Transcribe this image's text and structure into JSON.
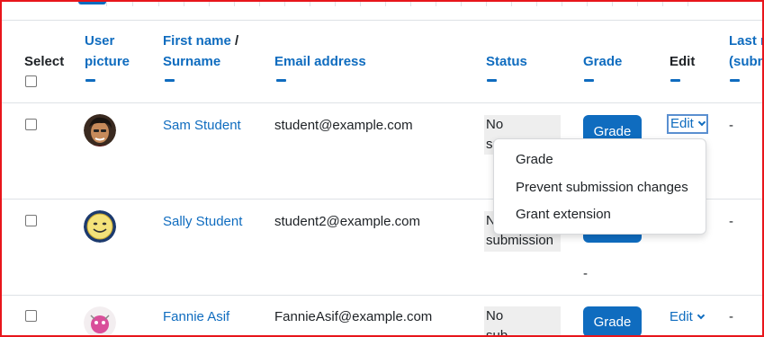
{
  "header": {
    "select": "Select",
    "user_picture_1": "User",
    "user_picture_2": "picture",
    "first_name": "First name",
    "slash": " /",
    "surname": "Surname",
    "email": "Email address",
    "status": "Status",
    "grade": "Grade",
    "edit": "Edit",
    "last_modified_1": "Last m",
    "last_modified_2": "(subm"
  },
  "rows": [
    {
      "name": "Sam Student",
      "email": "student@example.com",
      "status_1": "No",
      "status_2": "sub",
      "grade_button": "Grade",
      "edit_label": "Edit",
      "last_modified": "-"
    },
    {
      "name": "Sally Student",
      "email": "student2@example.com",
      "status_1": "N",
      "status_2": "submission",
      "grade_button": "",
      "edit_label": "",
      "last_modified": "-",
      "extra_dash": "-"
    },
    {
      "name": "Fannie Asif",
      "email": "FannieAsif@example.com",
      "status_1": "No",
      "status_2": "sub",
      "grade_button": "Grade",
      "edit_label": "Edit",
      "last_modified": "-"
    }
  ],
  "edit_menu": {
    "items": [
      "Grade",
      "Prevent submission changes",
      "Grant extension"
    ]
  },
  "colors": {
    "accent": "#0f6cbf",
    "border": "#e8151b"
  }
}
